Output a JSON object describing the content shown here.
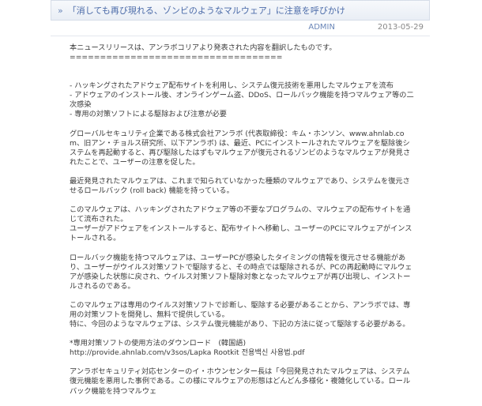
{
  "post": {
    "title_chevron": "»",
    "title": "「消しても再び現れる、ゾンビのようなマルウェア」に注意を呼びかけ",
    "author": "ADMIN",
    "date": "2013-05-29"
  },
  "body": {
    "intro": "本ニュースリリースは、アンラボコリアより発表された内容を翻訳したものです。",
    "separator": "===================================",
    "bullets": [
      "- ハッキングされたアドウェア配布サイトを利用し、システム復元技術を悪用したマルウェアを流布",
      "- アドウェアのインストール後、オンラインゲーム盗、DDoS、ロールバック機能を持つマルウェア等の二次感染",
      "- 専用の対策ソフトによる駆除および注意が必要"
    ],
    "para1": "グローバルセキュリティ企業である株式会社アンラボ (代表取締役：キム・ホンソン、www.ahnlab.com、旧アン・チョルス研究所、以下アンラボ) は、最近、PCにインストールされたマルウェアを駆除後システムを再起動すると、再び駆除したはずもマルウェアが復元されるゾンビのようなマルウェアが発見されたことで、ユーザーの注意を促した。",
    "para2": "最近発見されたマルウェアは、これまで知られていなかった種類のマルウェアであり、システムを復元させるロールバック (roll back) 機能を持っている。",
    "para3a": "このマルウェアは、ハッキングされたアドウェア等の不要なプログラムの、マルウェアの配布サイトを通じて流布された。",
    "para3b": "ユーザーがアドウェアをインストールすると、配布サイトへ移動し、ユーザーのPCにマルウェアがインストールされる。",
    "para4": "ロールバック機能を持つマルウェアは、ユーザーPCが感染したタイミングの情報を復元させる機能があり、ユーザーがウイルス対策ソフトで駆除すると、その時点では駆除されるが、PCの再起動時にマルウェアが感染した状態に戻され、ウイルス対策ソフト駆除対象となったマルウェアが再び出現し、インストールされるのである。",
    "para5a": "このマルウェアは専用のウイルス対策ソフトで診断し、駆除する必要があることから、アンラボでは、専用の対策ソフトを開発し、無料で提供している。",
    "para5b": "特に、今回のようなマルウェアは、システム復元機能があり、下記の方法に従って駆除する必要がある。",
    "download_label": "*専用対策ソフトの使用方法のダウンロード　(韓国語)",
    "download_url": "http://provide.ahnlab.com/v3sos/Lapka Rootkit 전용백신 사용법.pdf",
    "para6": "アンラボセキュリティ対応センターのイ・ホウンセンター長は「今回発見されたマルウェアは、システム復元機能を悪用した事例である。この様にマルウェアの形態はどんどん多様化・複雑化している。ロールバック機能を持つマルウェ"
  }
}
